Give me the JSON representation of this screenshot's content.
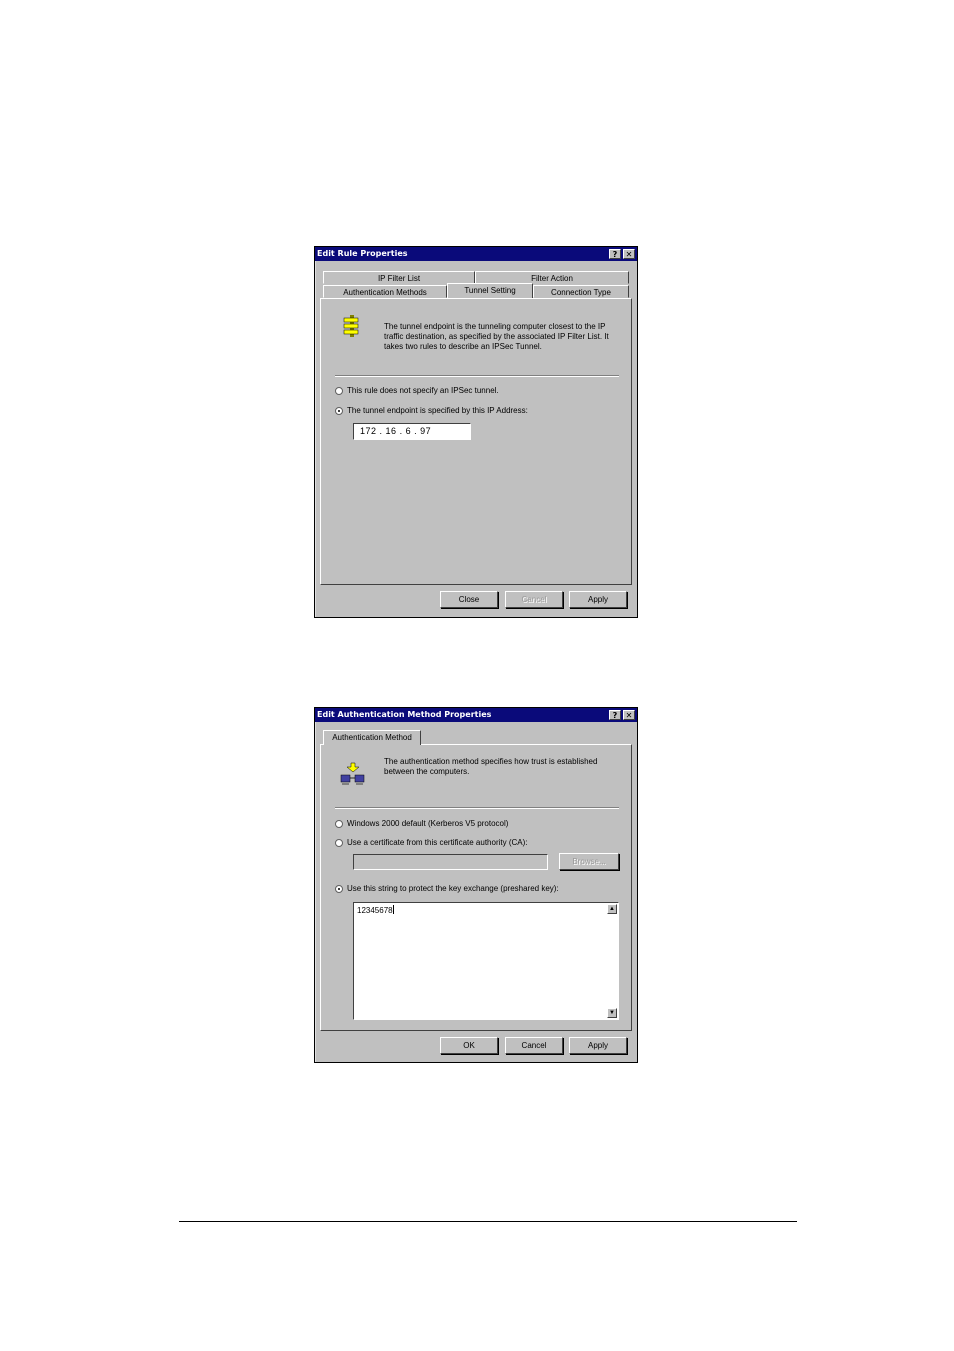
{
  "dialog1": {
    "title": "Edit Rule Properties",
    "help_btn": "?",
    "close_btn": "✕",
    "tabs_row1": [
      "IP Filter List",
      "Filter Action"
    ],
    "tabs_row2": [
      "Authentication Methods",
      "Tunnel Setting",
      "Connection Type"
    ],
    "active_tab": "Tunnel Setting",
    "description": "The tunnel endpoint is the tunneling computer closest to the IP traffic destination, as specified by the associated IP Filter List. It takes two rules to describe an IPSec Tunnel.",
    "option_no_tunnel": "This rule does not specify an IPSec tunnel.",
    "option_ip": "The tunnel endpoint is specified by this IP Address:",
    "selected_option": "option_ip",
    "ip": [
      "172",
      "16",
      "6",
      "97"
    ],
    "buttons": {
      "close": "Close",
      "cancel": "Cancel",
      "apply": "Apply"
    }
  },
  "dialog2": {
    "title": "Edit Authentication Method Properties",
    "help_btn": "?",
    "close_btn": "✕",
    "tab": "Authentication Method",
    "description": "The authentication method specifies how trust is established between the computers.",
    "option_kerberos": "Windows 2000 default (Kerberos V5 protocol)",
    "option_cert": "Use a certificate from this certificate authority (CA):",
    "browse_label": "Browse...",
    "option_preshared": "Use this string to protect the key exchange (preshared key):",
    "selected_option": "option_preshared",
    "preshared_value": "12345678",
    "buttons": {
      "ok": "OK",
      "cancel": "Cancel",
      "apply": "Apply"
    }
  }
}
